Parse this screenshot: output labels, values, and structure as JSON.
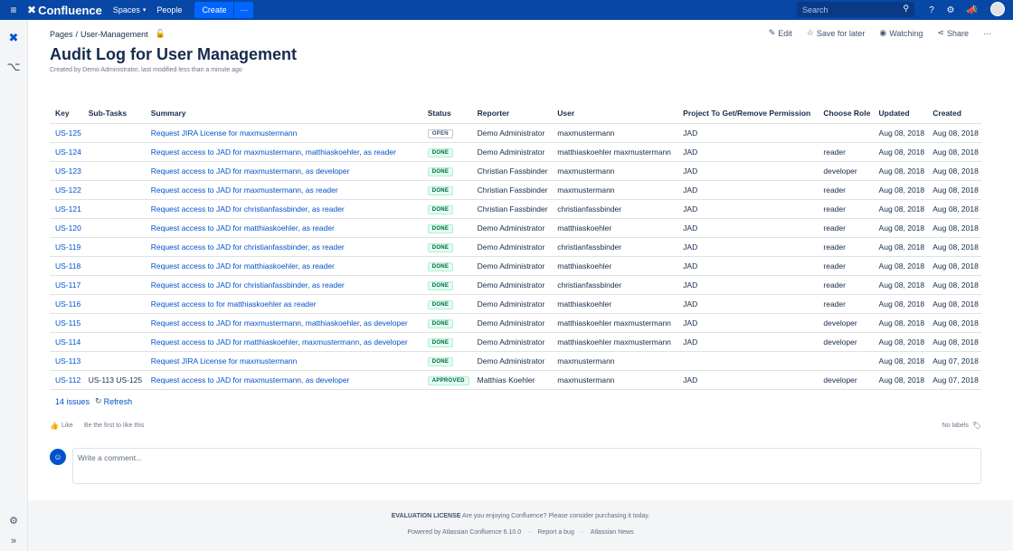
{
  "nav": {
    "menu_icon": "hamburger-icon",
    "brand": "Confluence",
    "spaces": "Spaces",
    "people": "People",
    "create": "Create",
    "more": "···",
    "search_placeholder": "Search"
  },
  "breadcrumb": {
    "pages": "Pages",
    "sep": "/",
    "current": "User-Management"
  },
  "actions": {
    "edit": "Edit",
    "save_later": "Save for later",
    "watching": "Watching",
    "share": "Share",
    "more": "···"
  },
  "page": {
    "title": "Audit Log for User Management",
    "byline": "Created by Demo Administrator, last modified less than a minute ago"
  },
  "table": {
    "headers": [
      "Key",
      "Sub-Tasks",
      "Summary",
      "Status",
      "Reporter",
      "User",
      "Project To Get/Remove Permission",
      "Choose Role",
      "Updated",
      "Created"
    ],
    "rows": [
      {
        "key": "US-125",
        "subtasks": "",
        "summary": "Request JIRA License for maxmustermann",
        "status": "OPEN",
        "reporter": "Demo Administrator",
        "user": "maxmustermann",
        "project": "JAD",
        "role": "",
        "updated": "Aug 08, 2018",
        "created": "Aug 08, 2018"
      },
      {
        "key": "US-124",
        "subtasks": "",
        "summary": "Request access to JAD for maxmustermann, matthiaskoehler, as reader",
        "status": "DONE",
        "reporter": "Demo Administrator",
        "user": "matthiaskoehler maxmustermann",
        "project": "JAD",
        "role": "reader",
        "updated": "Aug 08, 2018",
        "created": "Aug 08, 2018"
      },
      {
        "key": "US-123",
        "subtasks": "",
        "summary": "Request access to JAD for maxmustermann, as developer",
        "status": "DONE",
        "reporter": "Christian Fassbinder",
        "user": "maxmustermann",
        "project": "JAD",
        "role": "developer",
        "updated": "Aug 08, 2018",
        "created": "Aug 08, 2018"
      },
      {
        "key": "US-122",
        "subtasks": "",
        "summary": "Request access to JAD for maxmustermann, as reader",
        "status": "DONE",
        "reporter": "Christian Fassbinder",
        "user": "maxmustermann",
        "project": "JAD",
        "role": "reader",
        "updated": "Aug 08, 2018",
        "created": "Aug 08, 2018"
      },
      {
        "key": "US-121",
        "subtasks": "",
        "summary": "Request access to JAD for christianfassbinder, as reader",
        "status": "DONE",
        "reporter": "Christian Fassbinder",
        "user": "christianfassbinder",
        "project": "JAD",
        "role": "reader",
        "updated": "Aug 08, 2018",
        "created": "Aug 08, 2018"
      },
      {
        "key": "US-120",
        "subtasks": "",
        "summary": "Request access to JAD for matthiaskoehler, as reader",
        "status": "DONE",
        "reporter": "Demo Administrator",
        "user": "matthiaskoehler",
        "project": "JAD",
        "role": "reader",
        "updated": "Aug 08, 2018",
        "created": "Aug 08, 2018"
      },
      {
        "key": "US-119",
        "subtasks": "",
        "summary": "Request access to JAD for christianfassbinder, as reader",
        "status": "DONE",
        "reporter": "Demo Administrator",
        "user": "christianfassbinder",
        "project": "JAD",
        "role": "reader",
        "updated": "Aug 08, 2018",
        "created": "Aug 08, 2018"
      },
      {
        "key": "US-118",
        "subtasks": "",
        "summary": "Request access to JAD for matthiaskoehler, as reader",
        "status": "DONE",
        "reporter": "Demo Administrator",
        "user": "matthiaskoehler",
        "project": "JAD",
        "role": "reader",
        "updated": "Aug 08, 2018",
        "created": "Aug 08, 2018"
      },
      {
        "key": "US-117",
        "subtasks": "",
        "summary": "Request access to JAD for christianfassbinder, as reader",
        "status": "DONE",
        "reporter": "Demo Administrator",
        "user": "christianfassbinder",
        "project": "JAD",
        "role": "reader",
        "updated": "Aug 08, 2018",
        "created": "Aug 08, 2018"
      },
      {
        "key": "US-116",
        "subtasks": "",
        "summary": "Request access to for matthiaskoehler as reader",
        "status": "DONE",
        "reporter": "Demo Administrator",
        "user": "matthiaskoehler",
        "project": "JAD",
        "role": "reader",
        "updated": "Aug 08, 2018",
        "created": "Aug 08, 2018"
      },
      {
        "key": "US-115",
        "subtasks": "",
        "summary": "Request access to JAD for maxmustermann, matthiaskoehler, as developer",
        "status": "DONE",
        "reporter": "Demo Administrator",
        "user": "matthiaskoehler maxmustermann",
        "project": "JAD",
        "role": "developer",
        "updated": "Aug 08, 2018",
        "created": "Aug 08, 2018"
      },
      {
        "key": "US-114",
        "subtasks": "",
        "summary": "Request access to JAD for matthiaskoehler, maxmustermann, as developer",
        "status": "DONE",
        "reporter": "Demo Administrator",
        "user": "matthiaskoehler maxmustermann",
        "project": "JAD",
        "role": "developer",
        "updated": "Aug 08, 2018",
        "created": "Aug 08, 2018"
      },
      {
        "key": "US-113",
        "subtasks": "",
        "summary": "Request JIRA License for maxmustermann",
        "status": "DONE",
        "reporter": "Demo Administrator",
        "user": "maxmustermann",
        "project": "",
        "role": "",
        "updated": "Aug 08, 2018",
        "created": "Aug 07, 2018"
      },
      {
        "key": "US-112",
        "subtasks": "US-113 US-125",
        "summary": "Request access to JAD for maxmustermann, as developer",
        "status": "APPROVED",
        "reporter": "Matthias Koehler",
        "user": "maxmustermann",
        "project": "JAD",
        "role": "developer",
        "updated": "Aug 08, 2018",
        "created": "Aug 07, 2018"
      }
    ],
    "count": "14 issues",
    "refresh": "Refresh"
  },
  "social": {
    "like": "Like",
    "first": "Be the first to like this",
    "labels": "No labels"
  },
  "comment": {
    "placeholder": "Write a comment..."
  },
  "footer": {
    "license_bold": "EVALUATION LICENSE",
    "license_text": "Are you enjoying Confluence? Please consider purchasing it today.",
    "powered": "Powered by Atlassian Confluence 6.10.0",
    "report": "Report a bug",
    "news": "Atlassian News",
    "dot": "·"
  },
  "colors": {
    "nav_bg": "#0747a6",
    "link": "#0052cc",
    "done": "#006644"
  }
}
